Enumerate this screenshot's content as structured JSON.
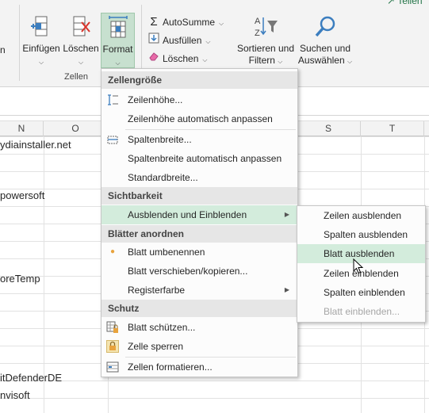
{
  "ribbon": {
    "partial_label": "n",
    "insert": {
      "label": "Einfügen"
    },
    "delete": {
      "label": "Löschen"
    },
    "format": {
      "label": "Format"
    },
    "group_zellen": "Zellen",
    "autosum": "AutoSumme",
    "fill": "Ausfüllen",
    "clear": "Löschen",
    "sort": {
      "line1": "Sortieren und",
      "line2": "Filtern"
    },
    "find": {
      "line1": "Suchen und",
      "line2": "Auswählen"
    },
    "share_partial": "Teilen"
  },
  "columns": [
    {
      "label": "N"
    },
    {
      "label": "O"
    },
    {
      "label": "S"
    },
    {
      "label": "T"
    }
  ],
  "cells": [
    "ydiainstaller.net",
    "powersoft",
    "oreTemp",
    "itDefenderDE",
    "nvisoft"
  ],
  "format_menu": {
    "sections": {
      "cell_size": "Zellengröße",
      "visibility": "Sichtbarkeit",
      "organize": "Blätter anordnen",
      "protection": "Schutz"
    },
    "items": {
      "row_height": "Zeilenhöhe...",
      "autofit_row": "Zeilenhöhe automatisch anpassen",
      "column_width": "Spaltenbreite...",
      "autofit_column": "Spaltenbreite automatisch anpassen",
      "default_width": "Standardbreite...",
      "hide_unhide": "Ausblenden und Einblenden",
      "rename": "Blatt umbenennen",
      "move_copy": "Blatt verschieben/kopieren...",
      "tab_color": "Registerfarbe",
      "protect_sheet": "Blatt schützen...",
      "lock_cell": "Zelle sperren",
      "format_cells": "Zellen formatieren..."
    }
  },
  "sub_menu": {
    "hide_rows": "Zeilen ausblenden",
    "hide_columns": "Spalten ausblenden",
    "hide_sheet": "Blatt ausblenden",
    "unhide_rows": "Zeilen einblenden",
    "unhide_columns": "Spalten einblenden",
    "unhide_sheet": "Blatt einblenden..."
  },
  "colors": {
    "accent": "#217346",
    "highlight": "#d3ecdc",
    "format_btn_bg": "#c7e0cf"
  },
  "icons": {
    "autosum": "sigma-icon",
    "fill": "fill-down-icon",
    "clear": "eraser-icon",
    "sort": "sort-filter-icon",
    "find": "magnifier-icon"
  }
}
